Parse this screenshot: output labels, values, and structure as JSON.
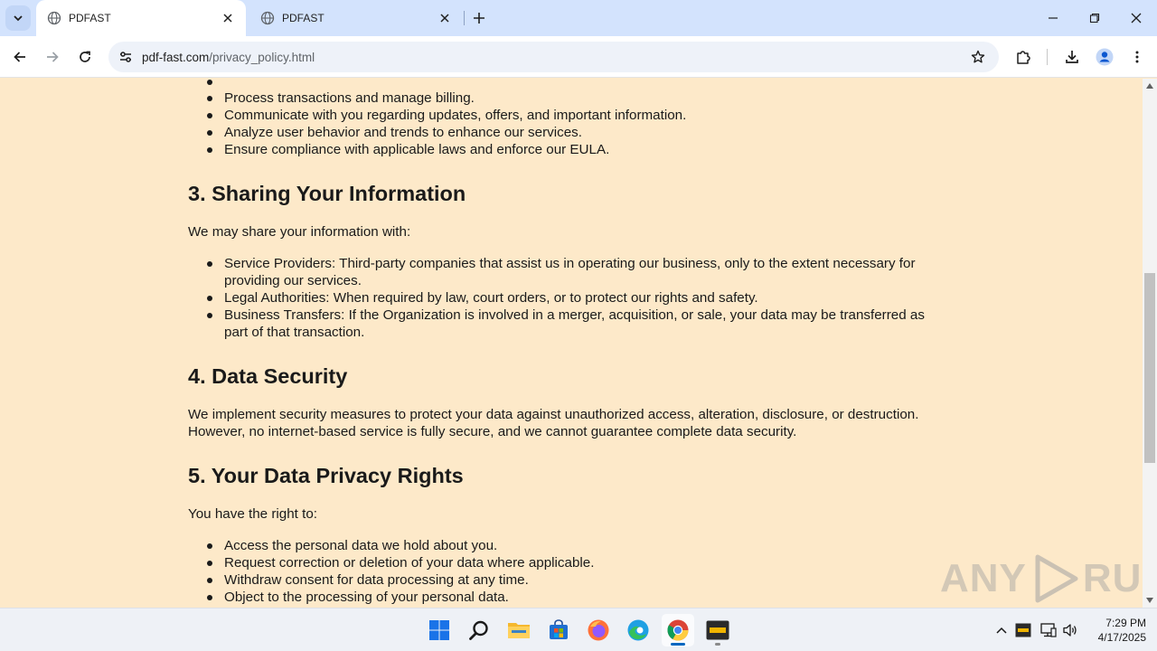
{
  "browser": {
    "tabs": [
      {
        "title": "PDFAST",
        "active": true
      },
      {
        "title": "PDFAST",
        "active": false
      }
    ],
    "url_host": "pdf-fast.com",
    "url_path": "/privacy_policy.html"
  },
  "content": {
    "list_use": [
      "Process transactions and manage billing.",
      "Communicate with you regarding updates, offers, and important information.",
      "Analyze user behavior and trends to enhance our services.",
      "Ensure compliance with applicable laws and enforce our EULA."
    ],
    "section3": {
      "heading": "3. Sharing Your Information",
      "intro": "We may share your information with:",
      "items": [
        "Service Providers: Third-party companies that assist us in operating our business, only to the extent necessary for providing our services.",
        "Legal Authorities: When required by law, court orders, or to protect our rights and safety.",
        "Business Transfers: If the Organization is involved in a merger, acquisition, or sale, your data may be transferred as part of that transaction."
      ]
    },
    "section4": {
      "heading": "4. Data Security",
      "body": "We implement security measures to protect your data against unauthorized access, alteration, disclosure, or destruction. However, no internet-based service is fully secure, and we cannot guarantee complete data security."
    },
    "section5": {
      "heading": "5. Your Data Privacy Rights",
      "intro": "You have the right to:",
      "items": [
        "Access the personal data we hold about you.",
        "Request correction or deletion of your data where applicable.",
        "Withdraw consent for data processing at any time.",
        "Object to the processing of your personal data."
      ]
    }
  },
  "watermark": {
    "left": "ANY",
    "right": "RUN"
  },
  "taskbar": {
    "apps": [
      "windows-start",
      "search",
      "file-explorer",
      "microsoft-store",
      "firefox",
      "edge",
      "chrome",
      "pdfast"
    ],
    "clock_time": "7:29 PM",
    "clock_date": "4/17/2025"
  },
  "colors": {
    "page_background": "#fde9c9",
    "tabstrip": "#d3e3fd",
    "omnibox": "#eef2f9"
  }
}
